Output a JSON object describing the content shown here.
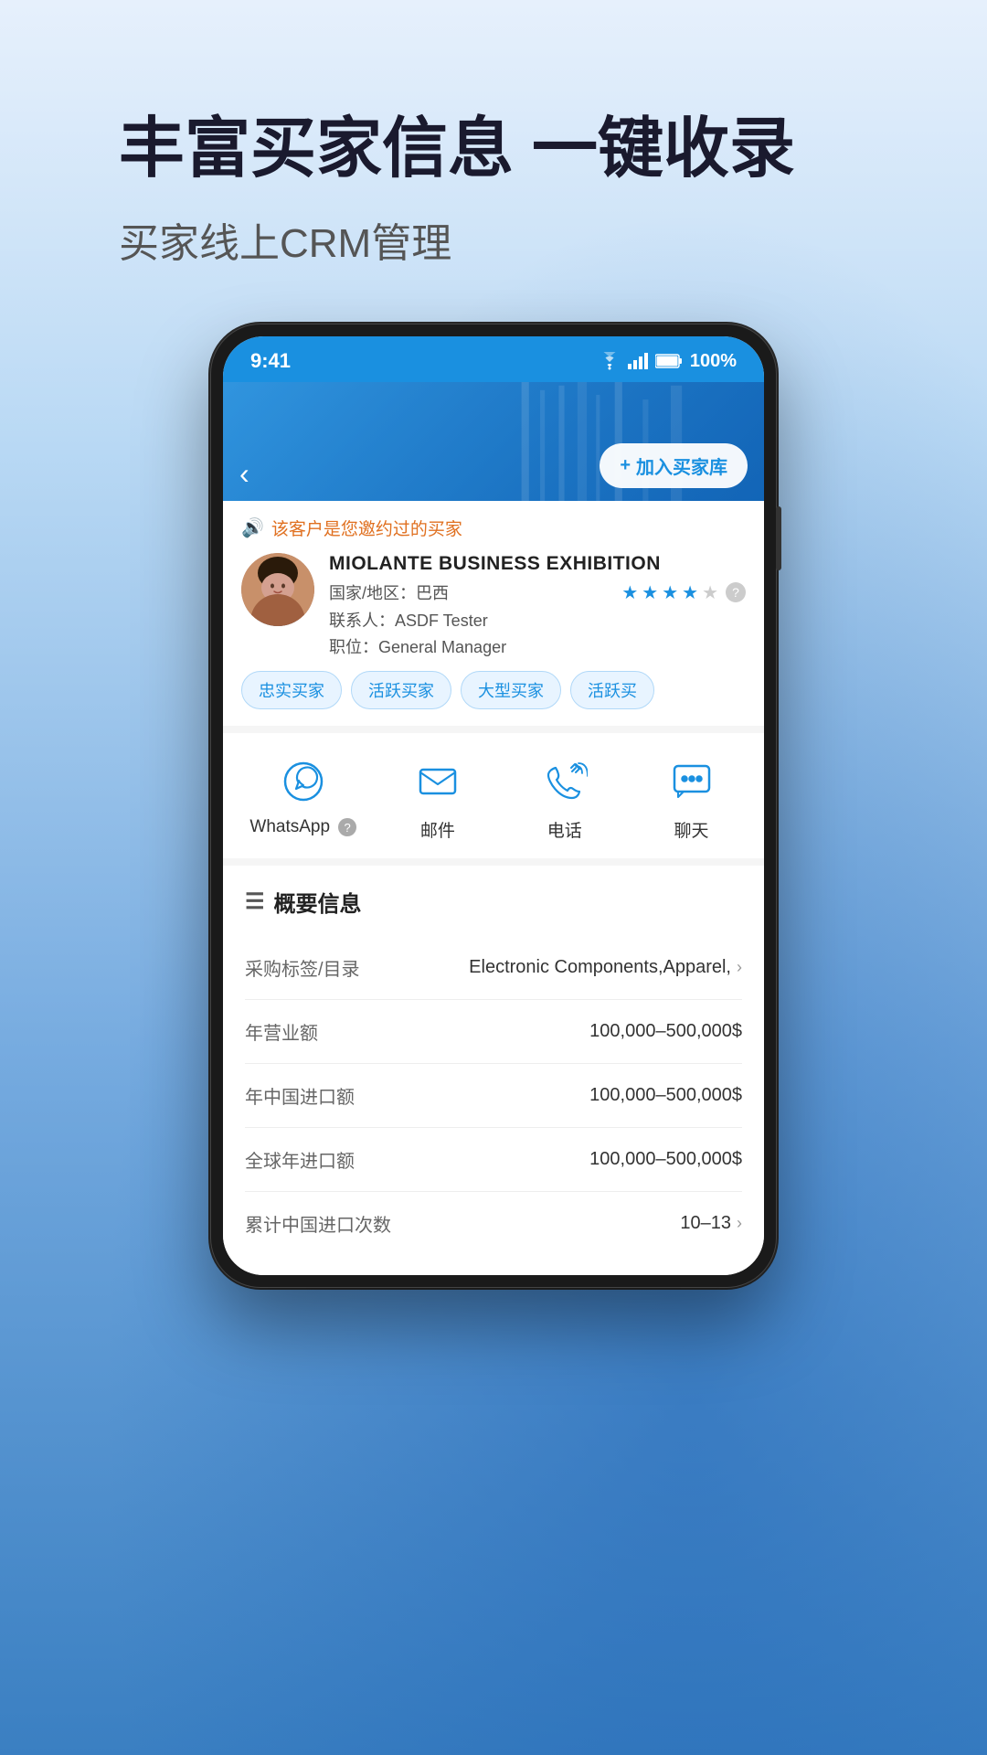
{
  "hero": {
    "title": "丰富买家信息 一键收录",
    "subtitle": "买家线上CRM管理"
  },
  "phone": {
    "status_bar": {
      "time": "9:41",
      "battery": "100%"
    },
    "header": {
      "back_label": "‹",
      "add_btn_icon": "+",
      "add_btn_label": "加入买家库"
    },
    "customer_card": {
      "alert_text": "该客户是您邀约过的买家",
      "company_name": "MIOLANTE BUSINESS EXHIBITION",
      "country_label": "国家/地区：",
      "country_value": "巴西",
      "stars": [
        true,
        true,
        true,
        true,
        false
      ],
      "contact_label": "联系人：",
      "contact_value": "ASDF Tester",
      "position_label": "职位：",
      "position_value": "General Manager",
      "tags": [
        "忠实买家",
        "活跃买家",
        "大型买家",
        "活跃买"
      ]
    },
    "actions": [
      {
        "id": "whatsapp",
        "label": "WhatsApp",
        "has_help": true,
        "icon_type": "whatsapp"
      },
      {
        "id": "email",
        "label": "邮件",
        "has_help": false,
        "icon_type": "email"
      },
      {
        "id": "phone",
        "label": "电话",
        "has_help": false,
        "icon_type": "phone"
      },
      {
        "id": "chat",
        "label": "聊天",
        "has_help": false,
        "icon_type": "chat"
      }
    ],
    "info_section": {
      "title": "概要信息",
      "rows": [
        {
          "label": "采购标签/目录",
          "value": "Electronic Components,Apparel,",
          "has_chevron": true
        },
        {
          "label": "年营业额",
          "value": "100,000–500,000$",
          "has_chevron": false
        },
        {
          "label": "年中国进口额",
          "value": "100,000–500,000$",
          "has_chevron": false
        },
        {
          "label": "全球年进口额",
          "value": "100,000–500,000$",
          "has_chevron": false
        },
        {
          "label": "累计中国进口次数",
          "value": "10–13",
          "has_chevron": true
        }
      ]
    }
  }
}
